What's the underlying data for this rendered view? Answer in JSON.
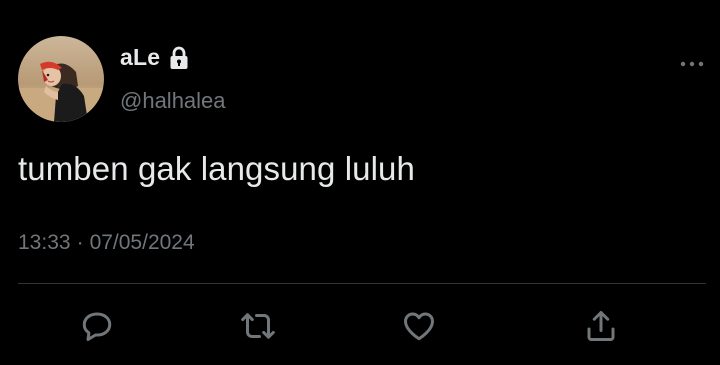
{
  "author": {
    "display_name": "aLe",
    "handle": "@halhalea",
    "protected_icon": "lock-icon",
    "avatar": "avatar"
  },
  "tweet": {
    "text": "tumben gak langsung luluh",
    "time": "13:33",
    "separator": "·",
    "date": "07/05/2024"
  },
  "actions": {
    "icons": [
      "reply-icon",
      "retweet-icon",
      "like-icon",
      "share-icon"
    ]
  },
  "menu_icon": "more-icon",
  "colors": {
    "background": "#000000",
    "primary_text": "#e7e9ea",
    "secondary_text": "#71767b",
    "divider": "#2f3336"
  }
}
